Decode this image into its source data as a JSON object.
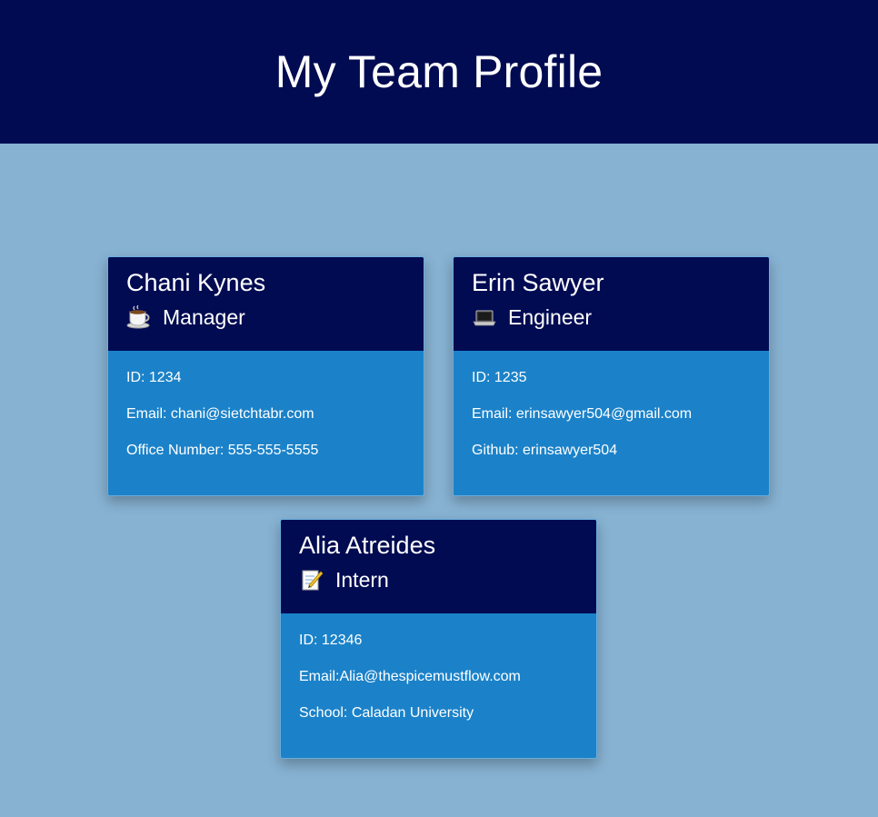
{
  "page": {
    "title": "My Team Profile"
  },
  "team": [
    {
      "name": "Chani Kynes",
      "role": "Manager",
      "icon": "coffee-cup-icon",
      "lines": [
        "ID: 1234",
        "Email: chani@sietchtabr.com",
        "Office Number: 555-555-5555"
      ]
    },
    {
      "name": "Erin Sawyer",
      "role": "Engineer",
      "icon": "laptop-icon",
      "lines": [
        "ID: 1235",
        "Email: erinsawyer504@gmail.com",
        "Github: erinsawyer504"
      ]
    },
    {
      "name": "Alia Atreides",
      "role": "Intern",
      "icon": "memo-icon",
      "lines": [
        "ID: 12346",
        "Email:Alia@thespicemustflow.com",
        "School: Caladan University"
      ]
    }
  ],
  "colors": {
    "header_bg": "#000b52",
    "page_bg": "#87b2d2",
    "card_body_bg": "#1b82c9"
  }
}
